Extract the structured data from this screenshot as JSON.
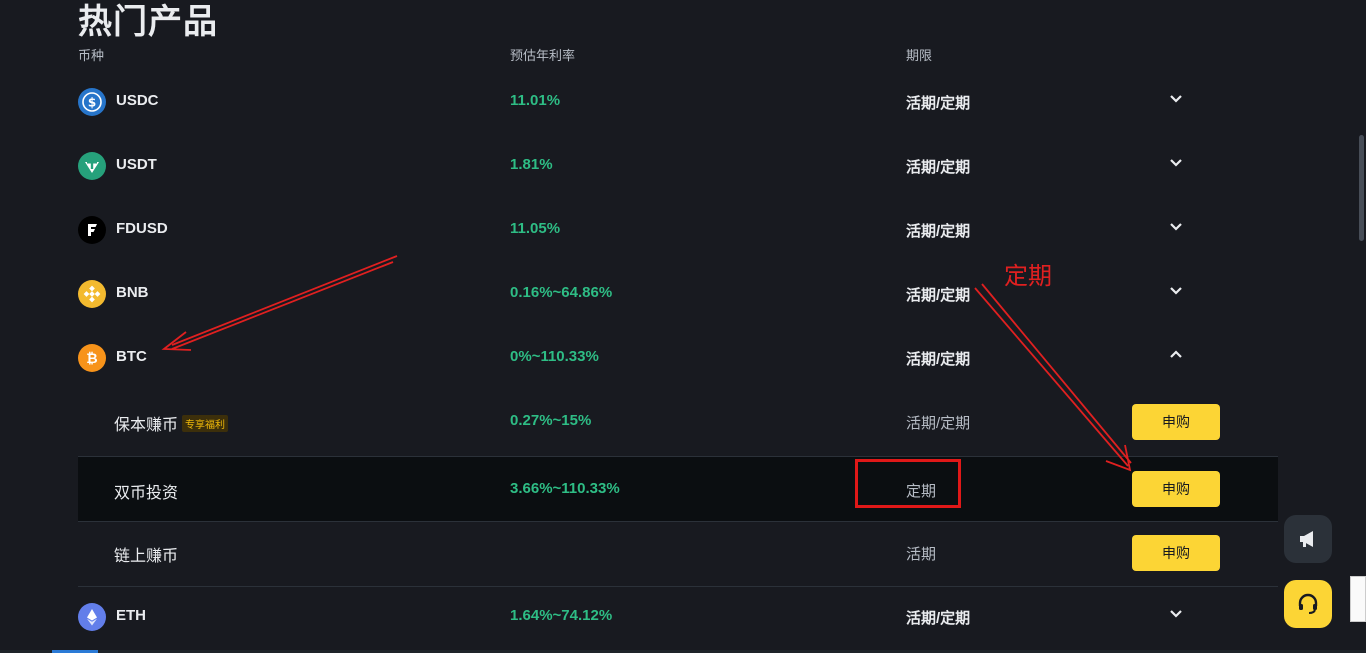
{
  "page": {
    "title": "热门产品"
  },
  "table": {
    "headers": {
      "coin": "币种",
      "apy": "预估年利率",
      "term": "期限"
    },
    "rows": [
      {
        "coin": "USDC",
        "apy": "11.01%",
        "term": "活期/定期"
      },
      {
        "coin": "USDT",
        "apy": "1.81%",
        "term": "活期/定期"
      },
      {
        "coin": "FDUSD",
        "apy": "11.05%",
        "term": "活期/定期"
      },
      {
        "coin": "BNB",
        "apy": "0.16%~64.86%",
        "term": "活期/定期"
      },
      {
        "coin": "BTC",
        "apy": "0%~110.33%",
        "term": "活期/定期"
      },
      {
        "coin": "ETH",
        "apy": "1.64%~74.12%",
        "term": "活期/定期"
      }
    ],
    "btc_products": [
      {
        "name": "保本赚币",
        "badge": "专享福利",
        "apy": "0.27%~15%",
        "term": "活期/定期",
        "button": "申购"
      },
      {
        "name": "双币投资",
        "apy": "3.66%~110.33%",
        "term": "定期",
        "button": "申购"
      },
      {
        "name": "链上赚币",
        "apy": "",
        "term": "活期",
        "button": "申购"
      }
    ]
  },
  "annotation": {
    "label": "定期",
    "color": "#e02020"
  },
  "colors": {
    "background": "#181a20",
    "green": "#2ebd85",
    "yellow": "#fcd535"
  },
  "icons": {
    "USDC": "usdc-icon",
    "USDT": "usdt-icon",
    "FDUSD": "fdusd-icon",
    "BNB": "bnb-icon",
    "BTC": "btc-icon",
    "ETH": "eth-icon",
    "float_1": "megaphone-icon",
    "float_2": "headset-icon"
  }
}
